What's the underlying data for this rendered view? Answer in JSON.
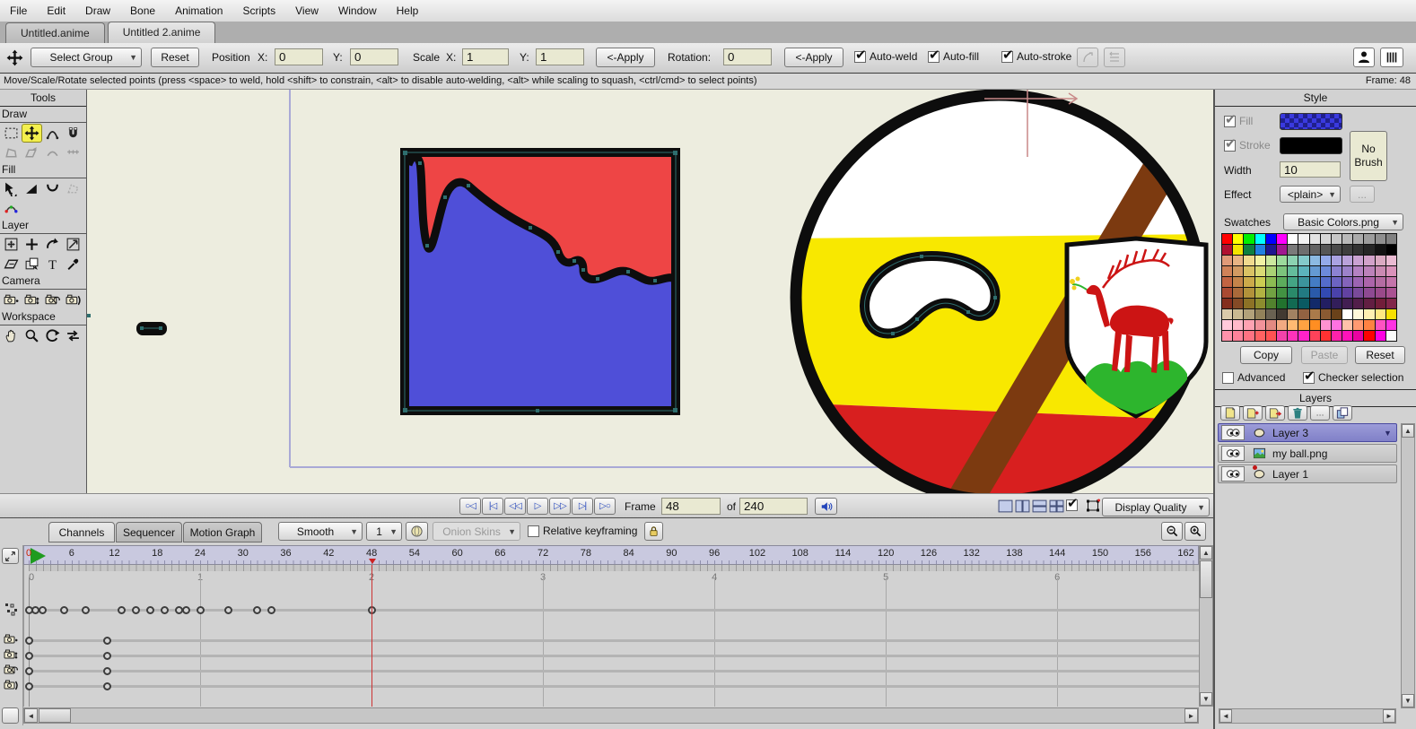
{
  "menu": {
    "items": [
      "File",
      "Edit",
      "Draw",
      "Bone",
      "Animation",
      "Scripts",
      "View",
      "Window",
      "Help"
    ]
  },
  "tabs": {
    "items": [
      {
        "label": "Untitled.anime",
        "active": false
      },
      {
        "label": "Untitled 2.anime",
        "active": true
      }
    ]
  },
  "toolbar": {
    "group_select": "Select Group",
    "reset_label": "Reset",
    "position_label": "Position",
    "x_label": "X:",
    "y_label": "Y:",
    "position_x": "0",
    "position_y": "0",
    "scale_label": "Scale",
    "scale_x": "1",
    "scale_y": "1",
    "apply_label": "<-Apply",
    "rotation_label": "Rotation:",
    "rotation_value": "0",
    "apply2_label": "<-Apply",
    "toggles": [
      {
        "label": "Auto-weld",
        "checked": true
      },
      {
        "label": "Auto-fill",
        "checked": true
      },
      {
        "label": "Auto-stroke",
        "checked": true
      }
    ]
  },
  "statusbar": {
    "hint": "Move/Scale/Rotate selected points (press <space> to weld, hold <shift> to constrain, <alt> to disable auto-welding, <alt> while scaling to squash, <ctrl/cmd> to select points)",
    "frame": "Frame: 48"
  },
  "tools": {
    "title": "Tools",
    "sections": [
      {
        "label": "Draw",
        "rows": [
          [
            {
              "icon": "select-rect"
            },
            {
              "icon": "move-cross",
              "state": "active"
            },
            {
              "icon": "arc-tool"
            },
            {
              "icon": "magnet"
            }
          ],
          [
            {
              "icon": "poly-gray",
              "state": "disabled"
            },
            {
              "icon": "shape-arrow-gray",
              "state": "disabled"
            },
            {
              "icon": "arc-gray",
              "state": "disabled"
            },
            {
              "icon": "hash-gray",
              "state": "disabled"
            }
          ]
        ]
      },
      {
        "label": "Fill",
        "rows": [
          [
            {
              "icon": "select-shape"
            },
            {
              "icon": "paint-bucket"
            },
            {
              "icon": "line-width"
            },
            {
              "icon": "poly-dash-gray",
              "state": "disabled"
            }
          ],
          [
            {
              "icon": "curve-points"
            }
          ]
        ]
      },
      {
        "label": "Layer",
        "rows": [
          [
            {
              "icon": "translate-layer"
            },
            {
              "icon": "plus"
            },
            {
              "icon": "rotate-arc"
            },
            {
              "icon": "flip-box"
            }
          ],
          [
            {
              "icon": "shear"
            },
            {
              "icon": "stack"
            },
            {
              "icon": "text"
            },
            {
              "icon": "eyedropper"
            }
          ]
        ]
      },
      {
        "label": "Camera",
        "rows": [
          [
            {
              "icon": "camera-plus"
            },
            {
              "icon": "camera-updown"
            },
            {
              "icon": "camera-rotate"
            },
            {
              "icon": "camera-roll"
            }
          ]
        ]
      },
      {
        "label": "Workspace",
        "rows": [
          [
            {
              "icon": "hand"
            },
            {
              "icon": "magnify"
            },
            {
              "icon": "rotate-cw"
            },
            {
              "icon": "swap-arrows"
            }
          ]
        ]
      }
    ]
  },
  "style_panel": {
    "title": "Style",
    "fill_label": "Fill",
    "fill_checked": true,
    "stroke_label": "Stroke",
    "stroke_checked": true,
    "stroke_color": "#000000",
    "no_brush_label": "No Brush",
    "width_label": "Width",
    "width_value": "10",
    "effect_label": "Effect",
    "effect_value": "<plain>",
    "more_label": "...",
    "swatches_label": "Swatches",
    "swatches_value": "Basic Colors.png",
    "copy_label": "Copy",
    "paste_label": "Paste",
    "reset_label": "Reset",
    "advanced_label": "Advanced",
    "advanced_checked": false,
    "checker_label": "Checker selection",
    "checker_checked": true,
    "palette_rows": [
      [
        "#ff0000",
        "#ffff00",
        "#00ee00",
        "#00ffff",
        "#0000ff",
        "#ff00ff",
        "#ffffff",
        "#f1f1f1",
        "#e3e3e3",
        "#d5d5d5",
        "#c7c7c7",
        "#b9b9b9",
        "#ababab",
        "#9d9d9d",
        "#8f8f8f",
        "#818181"
      ],
      [
        "#b01030",
        "#f2e500",
        "#0e8040",
        "#2080e0",
        "#1e1690",
        "#a01890",
        "#7a7a7a",
        "#6e6e6e",
        "#626262",
        "#565656",
        "#4a4a4a",
        "#3e3e3e",
        "#323232",
        "#262626",
        "#121212",
        "#000000"
      ],
      [
        "#e09a78",
        "#e8b484",
        "#f0da8e",
        "#f2f2a4",
        "#cce89e",
        "#9cda9c",
        "#8cd2b2",
        "#84caca",
        "#8cbae2",
        "#94aaea",
        "#aaa2e2",
        "#baa2da",
        "#caa2d2",
        "#d2a2ca",
        "#daaac2",
        "#eabad2"
      ],
      [
        "#d08258",
        "#d29a62",
        "#dac264",
        "#dada74",
        "#aad274",
        "#7cc47c",
        "#64bc9c",
        "#5cb4bc",
        "#649ad2",
        "#6c8ada",
        "#8c82d2",
        "#9c82ca",
        "#b482c2",
        "#bc82ba",
        "#ca8ab2",
        "#da92ba"
      ],
      [
        "#c26442",
        "#c4844a",
        "#ccaa4a",
        "#cccc52",
        "#8cbc52",
        "#5cac5c",
        "#44a484",
        "#3c949c",
        "#447cc4",
        "#546cca",
        "#6c64c2",
        "#8464ba",
        "#9c64b2",
        "#ac64aa",
        "#b46ca2",
        "#c474aa"
      ],
      [
        "#aa4a32",
        "#aa6a3a",
        "#b2923a",
        "#b2b242",
        "#72a242",
        "#429242",
        "#2a8a6a",
        "#227a82",
        "#2a5aaa",
        "#324ab2",
        "#4a42aa",
        "#6242a2",
        "#7a4a9a",
        "#8e4a92",
        "#9a4a8a",
        "#aa5292"
      ],
      [
        "#842e1e",
        "#844a26",
        "#8c7226",
        "#8c8c2e",
        "#52822e",
        "#22722e",
        "#126a52",
        "#0a5a62",
        "#122a6a",
        "#221e62",
        "#321e5a",
        "#421e52",
        "#521e4a",
        "#621e42",
        "#721e3a",
        "#82264a"
      ],
      [
        "#dacaaa",
        "#caba92",
        "#b2a27a",
        "#92825a",
        "#6a6252",
        "#423a32",
        "#a28262",
        "#926242",
        "#aa7a4a",
        "#8a5a32",
        "#6a421a",
        "#ffffff",
        "#fff8da",
        "#fff0b2",
        "#ffe882",
        "#f8e002"
      ],
      [
        "#ffcada",
        "#ffbaca",
        "#ffa2b2",
        "#f2929a",
        "#e28a82",
        "#f2aa82",
        "#ffba72",
        "#ffa242",
        "#ff8e22",
        "#ff92d2",
        "#ff72e2",
        "#ffc2aa",
        "#ff9a72",
        "#ff8242",
        "#ff52c2",
        "#ff32e2"
      ],
      [
        "#ff92aa",
        "#ff829a",
        "#ff7282",
        "#ff6262",
        "#ff5252",
        "#f242aa",
        "#ff32ba",
        "#ff22ca",
        "#ff425a",
        "#ff3232",
        "#ff22aa",
        "#ff12ba",
        "#ea02a2",
        "#ff0202",
        "#ff02e2",
        "#fbfbfb"
      ]
    ]
  },
  "layers_panel": {
    "title": "Layers",
    "buttons": [
      "new-layer",
      "add-layer",
      "insert-layer",
      "delete-layer",
      "more",
      "duplicate-layer"
    ],
    "items": [
      {
        "name": "Layer 3",
        "type": "vector",
        "selected": true
      },
      {
        "name": "my ball.png",
        "type": "image",
        "selected": false
      },
      {
        "name": "Layer 1",
        "type": "vector-modified",
        "selected": false
      }
    ]
  },
  "playback": {
    "buttons": [
      "jump-start",
      "step-start",
      "step-back",
      "play",
      "step-forward",
      "jump-end",
      "loop"
    ],
    "frame_label": "Frame",
    "frame_value": "48",
    "of_label": "of",
    "total_value": "240",
    "display_quality": "Display Quality"
  },
  "timeline": {
    "tabs": [
      {
        "label": "Channels",
        "active": true
      },
      {
        "label": "Sequencer",
        "active": false
      },
      {
        "label": "Motion Graph",
        "active": false
      }
    ],
    "interp_value": "Smooth",
    "step_value": "1",
    "onion_label": "Onion Skins",
    "relative_label": "Relative keyframing",
    "relative_checked": false,
    "frame_labels": [
      0,
      6,
      12,
      18,
      24,
      30,
      36,
      42,
      48,
      54,
      60,
      66,
      72,
      78,
      84,
      90,
      96,
      102,
      108,
      114,
      120,
      126,
      132,
      138,
      144,
      150,
      156,
      162
    ],
    "seconds_labels": [
      0,
      1,
      2,
      3,
      4,
      5,
      6
    ],
    "current_frame": 48,
    "frames_per_second": 24,
    "channels": [
      {
        "icon": "points",
        "keys": [
          0,
          1,
          2,
          5,
          8,
          13,
          15,
          17,
          19,
          21,
          22,
          24,
          28,
          32,
          34,
          48
        ]
      },
      {
        "icon": "camera-plus",
        "keys": [
          0,
          11
        ]
      },
      {
        "icon": "camera-updown",
        "keys": [
          0,
          11
        ]
      },
      {
        "icon": "camera-rotate",
        "keys": [
          0,
          11
        ]
      },
      {
        "icon": "camera-roll",
        "keys": [
          0,
          11
        ]
      }
    ]
  },
  "canvas": {
    "colors": {
      "bg": "#ededdf",
      "frame": "#a9a9d6",
      "red": "#ee4545",
      "blue": "#4f4fd8",
      "outline": "#0d0d0d",
      "ball_white": "#ffffff",
      "ball_yellow": "#f8e800",
      "ball_red": "#d81f1f",
      "stripe_brown": "#7c3a10",
      "deer_red": "#cc1414",
      "shield_green": "#2db52d",
      "flower_yellow": "#f0d020",
      "select_teal": "#2e6e6e",
      "origin_rose": "#c98989"
    }
  }
}
